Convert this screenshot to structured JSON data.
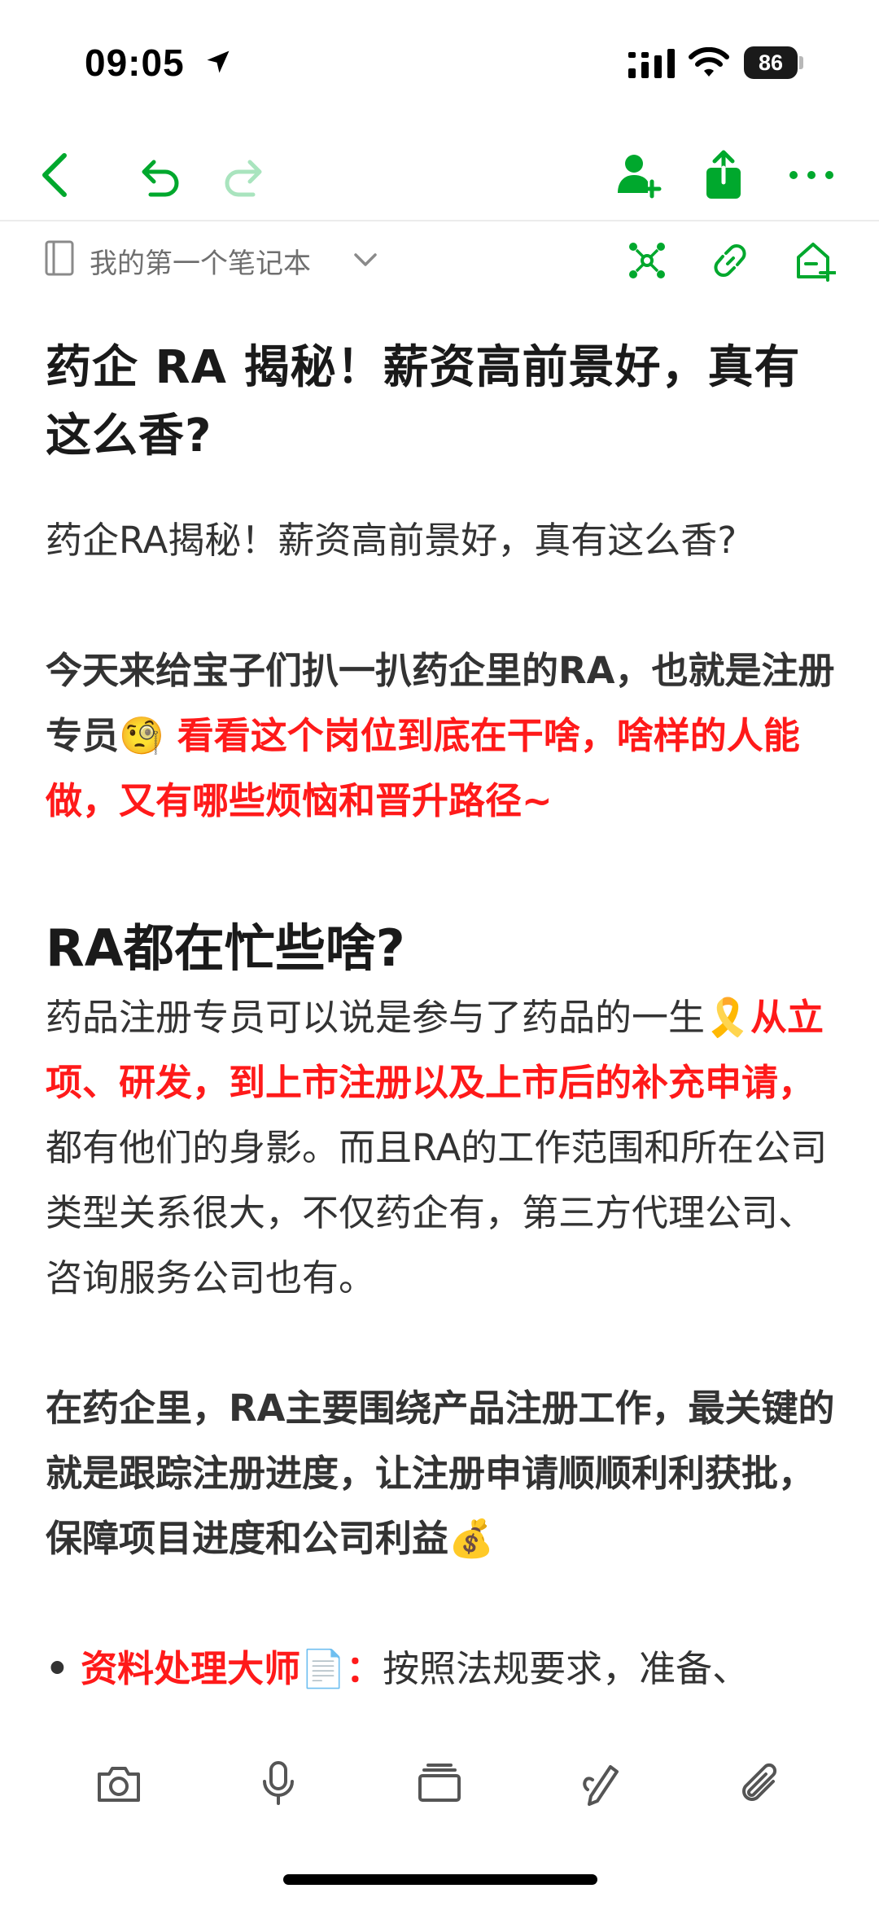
{
  "status_bar": {
    "time": "09:05",
    "battery": "86",
    "icons": [
      "location-arrow-icon",
      "signal-icon",
      "wifi-icon",
      "battery-icon"
    ]
  },
  "toolbar": {
    "icons": [
      "back-icon",
      "undo-icon",
      "redo-icon",
      "share-user-icon",
      "export-icon",
      "more-icon"
    ],
    "accent_color": "#00a82d"
  },
  "notebook": {
    "name": "我的第一个笔记本",
    "icons": [
      "notebook-icon",
      "chevron-down-icon",
      "mind-map-icon",
      "link-icon",
      "home-add-icon"
    ]
  },
  "note": {
    "title": "药企 RA 揭秘！薪资高前景好，真有这么香?",
    "intro": "药企RA揭秘！薪资高前景好，真有这么香?",
    "p1_bold": "今天来给宝子们扒一扒药企里的RA，也就是注册专员",
    "p1_emoji": "🧐",
    "p1_red": " 看看这个岗位到底在干啥，啥样的人能做，又有哪些烦恼和晋升路径~",
    "h2": "RA都在忙些啥?",
    "p2_text": "药品注册专员可以说是参与了药品的一生",
    "p2_emoji": "🎗️",
    "p2_red": "从立项、研发，到上市注册以及上市后的补充申请，",
    "p2_rest": "都有他们的身影。而且RA的工作范围和所在公司类型关系很大，不仅药企有，第三方代理公司、咨询服务公司也有。",
    "p3_bold": "在药企里，RA主要围绕产品注册工作，最关键的就是跟踪注册进度，让注册申请顺顺利利获批，保障项目进度和公司利益",
    "p3_emoji": "💰",
    "bullet_mark": "•",
    "bullet_red": "资料处理大师",
    "bullet_emoji": "📄",
    "bullet_colon": "：",
    "bullet_text": "按照法规要求，准备、"
  },
  "bottom_bar": {
    "icons": [
      "camera-icon",
      "microphone-icon",
      "templates-icon",
      "pen-icon",
      "attachment-icon"
    ]
  }
}
